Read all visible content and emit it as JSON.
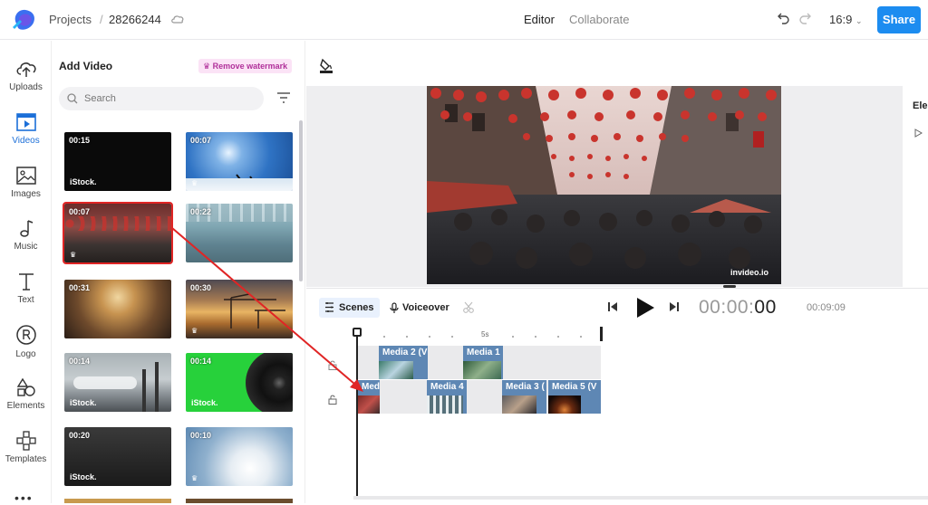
{
  "header": {
    "breadcrumb_projects": "Projects",
    "breadcrumb_sep": "/",
    "project_id": "28266244",
    "tab_editor": "Editor",
    "tab_collaborate": "Collaborate",
    "aspect_ratio": "16:9",
    "share_label": "Share"
  },
  "rail": {
    "items": [
      {
        "label": "Uploads",
        "icon": "upload-cloud-icon"
      },
      {
        "label": "Videos",
        "icon": "video-icon"
      },
      {
        "label": "Images",
        "icon": "image-icon"
      },
      {
        "label": "Music",
        "icon": "music-note-icon"
      },
      {
        "label": "Text",
        "icon": "text-icon"
      },
      {
        "label": "Logo",
        "icon": "logo-r-icon"
      },
      {
        "label": "Elements",
        "icon": "shapes-icon"
      },
      {
        "label": "Templates",
        "icon": "templates-grid-icon"
      }
    ],
    "more": "•••"
  },
  "panel": {
    "title": "Add Video",
    "watermark_label": "Remove watermark",
    "search_placeholder": "Search",
    "videos": [
      {
        "duration": "00:15",
        "watermark": "iStock."
      },
      {
        "duration": "00:07",
        "watermark": ""
      },
      {
        "duration": "00:07",
        "watermark": ""
      },
      {
        "duration": "00:22",
        "watermark": ""
      },
      {
        "duration": "00:31",
        "watermark": ""
      },
      {
        "duration": "00:30",
        "watermark": ""
      },
      {
        "duration": "00:14",
        "watermark": "iStock."
      },
      {
        "duration": "00:14",
        "watermark": "iStock."
      },
      {
        "duration": "00:20",
        "watermark": "iStock."
      },
      {
        "duration": "00:10",
        "watermark": ""
      }
    ]
  },
  "preview": {
    "brand": "invideo.io",
    "right_panel_label": "Ele"
  },
  "timeline_bar": {
    "scenes_label": "Scenes",
    "voiceover_label": "Voiceover",
    "timecode_dim": "00:00:",
    "timecode_bold": "00",
    "total_duration": "00:09:09"
  },
  "timeline": {
    "ruler_mark": "5s",
    "top_clips": [
      {
        "label": "Media 2 (V"
      },
      {
        "label": "Media 1"
      }
    ],
    "bottom_clips": [
      {
        "label": "Med"
      },
      {
        "label": "Media 4"
      },
      {
        "label": "Media 3 ("
      },
      {
        "label": "Media 5 (V"
      }
    ]
  },
  "colors": {
    "accent": "#1c8cf0",
    "selection": "#e02525",
    "clip": "#5e87b4",
    "watermark_badge_bg": "#fbe3f6",
    "watermark_badge_text": "#b0309a"
  }
}
